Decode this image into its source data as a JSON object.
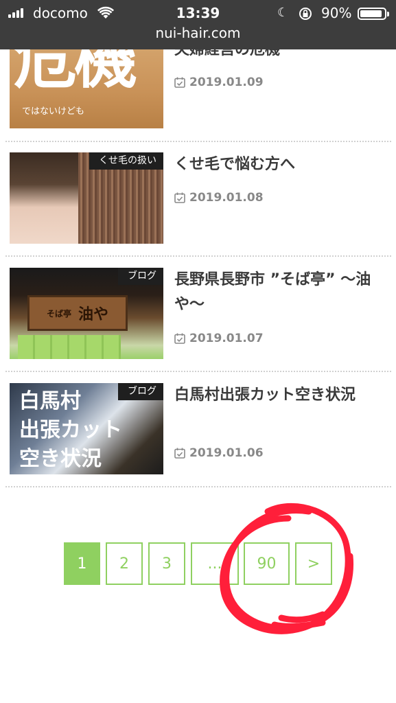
{
  "status_bar": {
    "carrier": "docomo",
    "time": "13:39",
    "battery": "90%",
    "battery_level": 0.9
  },
  "browser": {
    "url": "nui-hair.com"
  },
  "posts": [
    {
      "badge": "",
      "title": "夫婦経営の危機",
      "date": "2019.01.09",
      "thumb_big": "危機",
      "thumb_small": "ではないけども"
    },
    {
      "badge": "くせ毛の扱い",
      "title": "くせ毛で悩む方へ",
      "date": "2019.01.08"
    },
    {
      "badge": "ブログ",
      "title": "長野県長野市 ”そば亭” 〜油や〜",
      "date": "2019.01.07",
      "thumb_sign_small": "そば亭",
      "thumb_sign_big": "油や"
    },
    {
      "badge": "ブログ",
      "title": "白馬村出張カット空き状況",
      "date": "2019.01.06",
      "thumb_text": [
        "白馬村",
        "出張カット",
        "空き状況"
      ]
    }
  ],
  "pagination": {
    "pages": [
      "1",
      "2",
      "3",
      "...",
      "90"
    ],
    "next": ">",
    "current": "1"
  },
  "colors": {
    "accent": "#8fd060",
    "annotation": "#ff1f3a",
    "statusbar": "#3d3d3d"
  }
}
